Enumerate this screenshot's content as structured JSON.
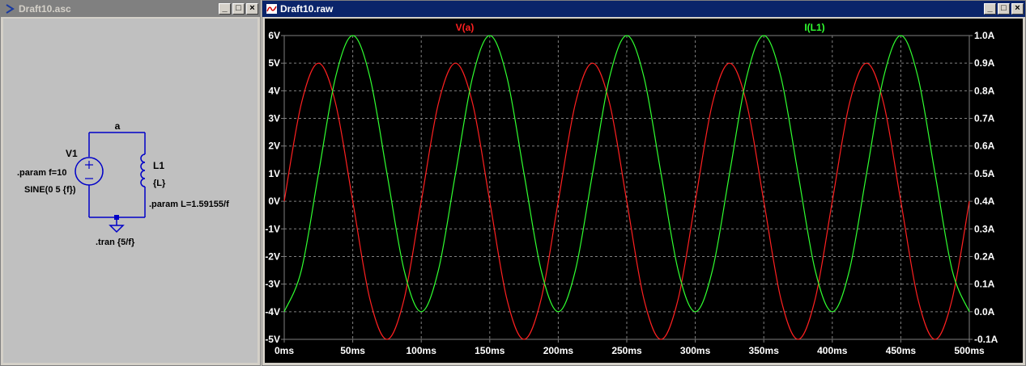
{
  "schematic_window": {
    "title": "Draft10.asc",
    "net_label": "a",
    "v1": {
      "name": "V1",
      "param": ".param f=10",
      "value": "SINE(0 5 {f})"
    },
    "l1": {
      "name": "L1",
      "value": "{L}",
      "param": ".param L=1.59155/f"
    },
    "tran": ".tran {5/f}"
  },
  "plot_window": {
    "title": "Draft10.raw",
    "accent_colors": {
      "voltage": "#ff2020",
      "current": "#30ff30",
      "grid": "#808080",
      "text": "#ffffff"
    }
  },
  "chart_data": {
    "type": "line",
    "title": "",
    "x_ticks": [
      "0ms",
      "50ms",
      "100ms",
      "150ms",
      "200ms",
      "250ms",
      "300ms",
      "350ms",
      "400ms",
      "450ms",
      "500ms"
    ],
    "left_ticks": [
      "6V",
      "5V",
      "4V",
      "3V",
      "2V",
      "1V",
      "0V",
      "-1V",
      "-2V",
      "-3V",
      "-4V",
      "-5V"
    ],
    "right_ticks": [
      "1.0A",
      "0.9A",
      "0.8A",
      "0.7A",
      "0.6A",
      "0.5A",
      "0.4A",
      "0.3A",
      "0.2A",
      "0.1A",
      "0.0A",
      "-0.1A"
    ],
    "xlim": [
      0,
      500
    ],
    "ylim_left": [
      -5,
      6
    ],
    "ylim_right": [
      -0.1,
      1.0
    ],
    "grid": true,
    "series": [
      {
        "name": "V(a)",
        "axis": "left",
        "color": "#ff2020",
        "x": [
          0,
          12.5,
          25,
          37.5,
          50,
          62.5,
          75,
          87.5,
          100,
          112.5,
          125,
          137.5,
          150,
          162.5,
          175,
          187.5,
          200,
          212.5,
          225,
          237.5,
          250,
          262.5,
          275,
          287.5,
          300,
          312.5,
          325,
          337.5,
          350,
          362.5,
          375,
          387.5,
          400,
          412.5,
          425,
          437.5,
          450,
          462.5,
          475,
          487.5,
          500
        ],
        "values": [
          0,
          3.54,
          5,
          3.54,
          0,
          -3.54,
          -5,
          -3.54,
          0,
          3.54,
          5,
          3.54,
          0,
          -3.54,
          -5,
          -3.54,
          0,
          3.54,
          5,
          3.54,
          0,
          -3.54,
          -5,
          -3.54,
          0,
          3.54,
          5,
          3.54,
          0,
          -3.54,
          -5,
          -3.54,
          0,
          3.54,
          5,
          3.54,
          0,
          -3.54,
          -5,
          -3.54,
          0
        ]
      },
      {
        "name": "I(L1)",
        "axis": "right",
        "color": "#30ff30",
        "x": [
          0,
          12.5,
          25,
          37.5,
          50,
          62.5,
          75,
          87.5,
          100,
          112.5,
          125,
          137.5,
          150,
          162.5,
          175,
          187.5,
          200,
          212.5,
          225,
          237.5,
          250,
          262.5,
          275,
          287.5,
          300,
          312.5,
          325,
          337.5,
          350,
          362.5,
          375,
          387.5,
          400,
          412.5,
          425,
          437.5,
          450,
          462.5,
          475,
          487.5,
          500
        ],
        "values": [
          0,
          0.15,
          0.5,
          0.85,
          1.0,
          0.85,
          0.5,
          0.15,
          0,
          0.15,
          0.5,
          0.85,
          1.0,
          0.85,
          0.5,
          0.15,
          0,
          0.15,
          0.5,
          0.85,
          1.0,
          0.85,
          0.5,
          0.15,
          0,
          0.15,
          0.5,
          0.85,
          1.0,
          0.85,
          0.5,
          0.15,
          0,
          0.15,
          0.5,
          0.85,
          1.0,
          0.85,
          0.5,
          0.15,
          0
        ]
      }
    ]
  }
}
